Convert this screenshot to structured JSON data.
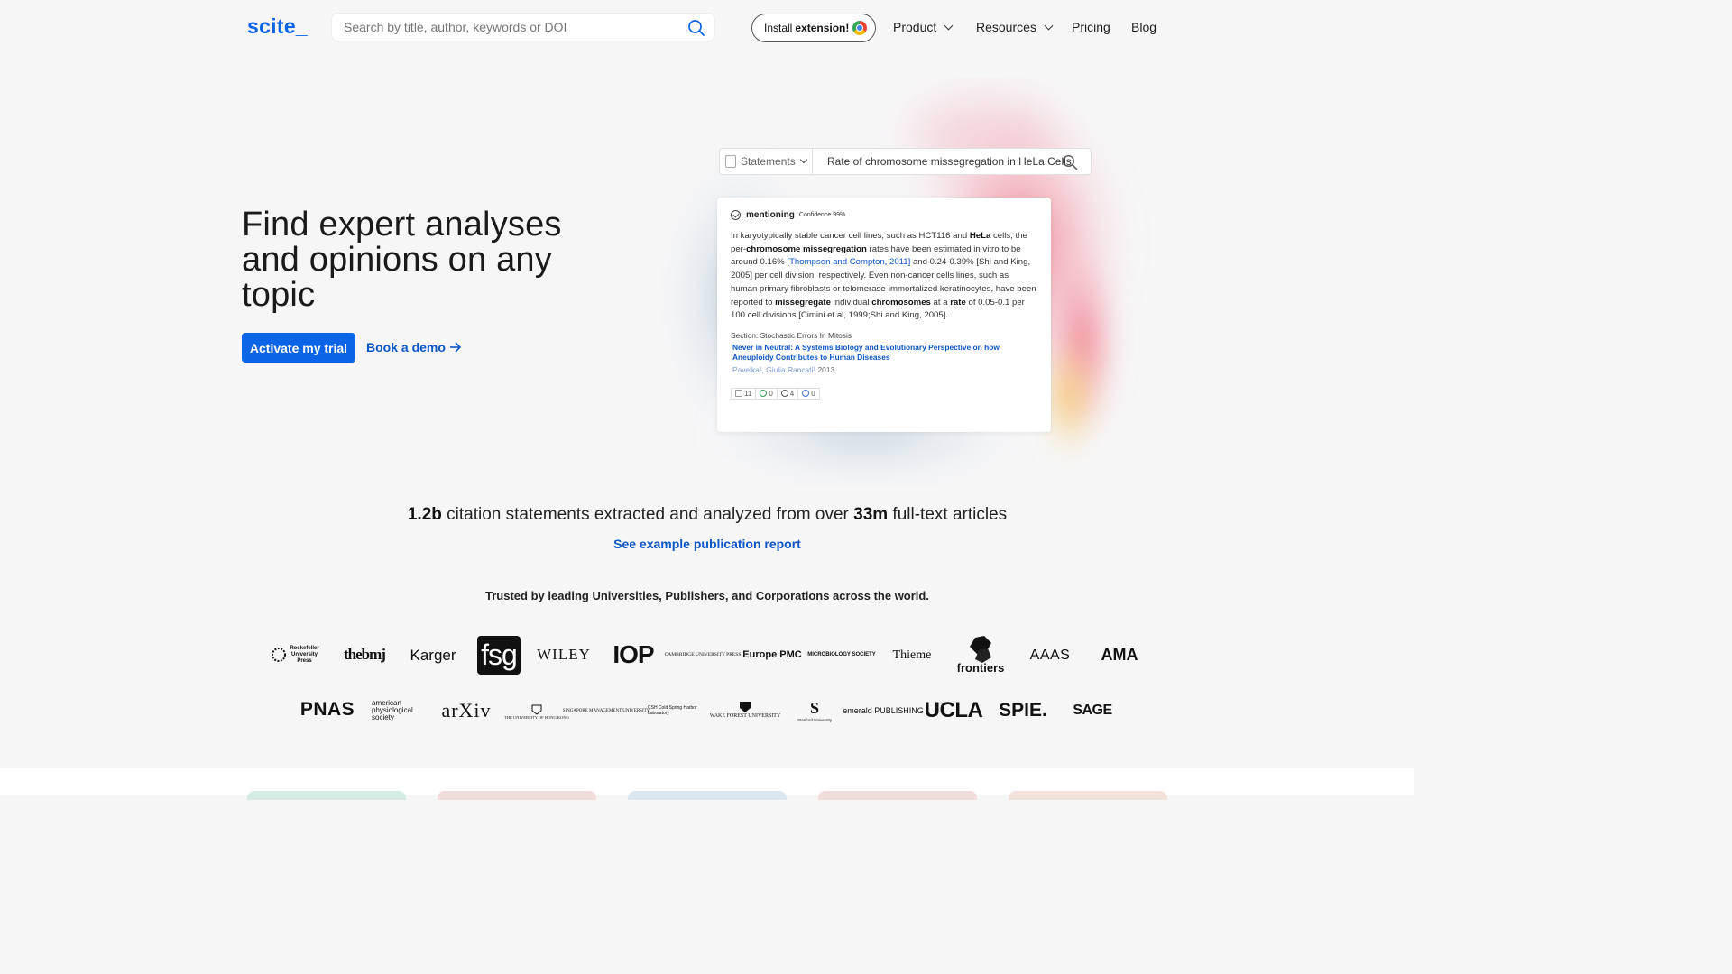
{
  "header": {
    "logo": "scite_",
    "search_placeholder": "Search by title, author, keywords or DOI",
    "install_prefix": "Install",
    "install_bold": "extension!",
    "nav": {
      "product": "Product",
      "resources": "Resources",
      "pricing": "Pricing",
      "blog": "Blog"
    }
  },
  "hero": {
    "title": "Find expert analyses and opinions on any topic",
    "primary_cta": "Activate my trial",
    "demo_cta": "Book a demo"
  },
  "illustration": {
    "select_label": "Statements",
    "query": "Rate of chromosome missegregation in HeLa Cells",
    "card": {
      "classification": "mentioning",
      "confidence": "Confidence 99%",
      "text_parts": {
        "p1": "In karyotypically stable cancer cell lines, such as HCT116 and ",
        "b1": "HeLa",
        "p2": " cells, the per-",
        "b2": "chromosome missegregation",
        "p3": " rates have been estimated in vitro to be around 0.16% ",
        "cite": "[Thompson and Compton, 2011]",
        "p4": " and 0.24-0.39% [Shi and King, 2005] per cell division, respectively. Even non-cancer cells lines, such as human primary fibroblasts or telomerase-immortalized keratinocytes, have been reported to ",
        "b3": "missegregate",
        "p5": " individual ",
        "b4": "chromosomes",
        "p6": " at a ",
        "b5": "rate",
        "p7": " of 0.05-0.1 per 100 cell divisions [Cimini et al, 1999;Shi and King, 2005]."
      },
      "section": "Section: Stochastic Errors In Mitosis",
      "paper_title": "Never in Neutral: A Systems Biology and Evolutionary Perspective on how Aneuploidy Contributes to Human Diseases",
      "authors": "Pavelka¹, Giulia Rancati¹",
      "year": "2013",
      "badges": [
        "11",
        "0",
        "4",
        "0"
      ]
    }
  },
  "stats": {
    "num1": "1.2b",
    "text1": " citation statements extracted and analyzed from over ",
    "num2": "33m",
    "text2": " full-text articles",
    "report_link": "See example publication report"
  },
  "trusted": "Trusted by leading Universities, Publishers, and Corporations across the world.",
  "partners_row1": [
    "Rockefeller University Press",
    "thebmj",
    "Karger",
    "fsg",
    "WILEY",
    "IOP",
    "CAMBRIDGE UNIVERSITY PRESS",
    "Europe PMC",
    "MICROBIOLOGY SOCIETY",
    "Thieme",
    "frontiers",
    "AAAS",
    "AMA"
  ],
  "partners_row2": [
    "PNAS",
    "american physiological society",
    "arXiv",
    "THE UNIVERSITY OF HONG KONG",
    "SINGAPORE MANAGEMENT UNIVERSITY",
    "CSH Cold Spring Harbor Laboratory",
    "WAKE FOREST UNIVERSITY",
    "Stanford University",
    "emerald PUBLISHING",
    "UCLA",
    "SPIE.",
    "SAGE"
  ],
  "colors": {
    "accent": "#0b63e5",
    "link": "#0b56c9",
    "background": "#f6f6f7"
  }
}
